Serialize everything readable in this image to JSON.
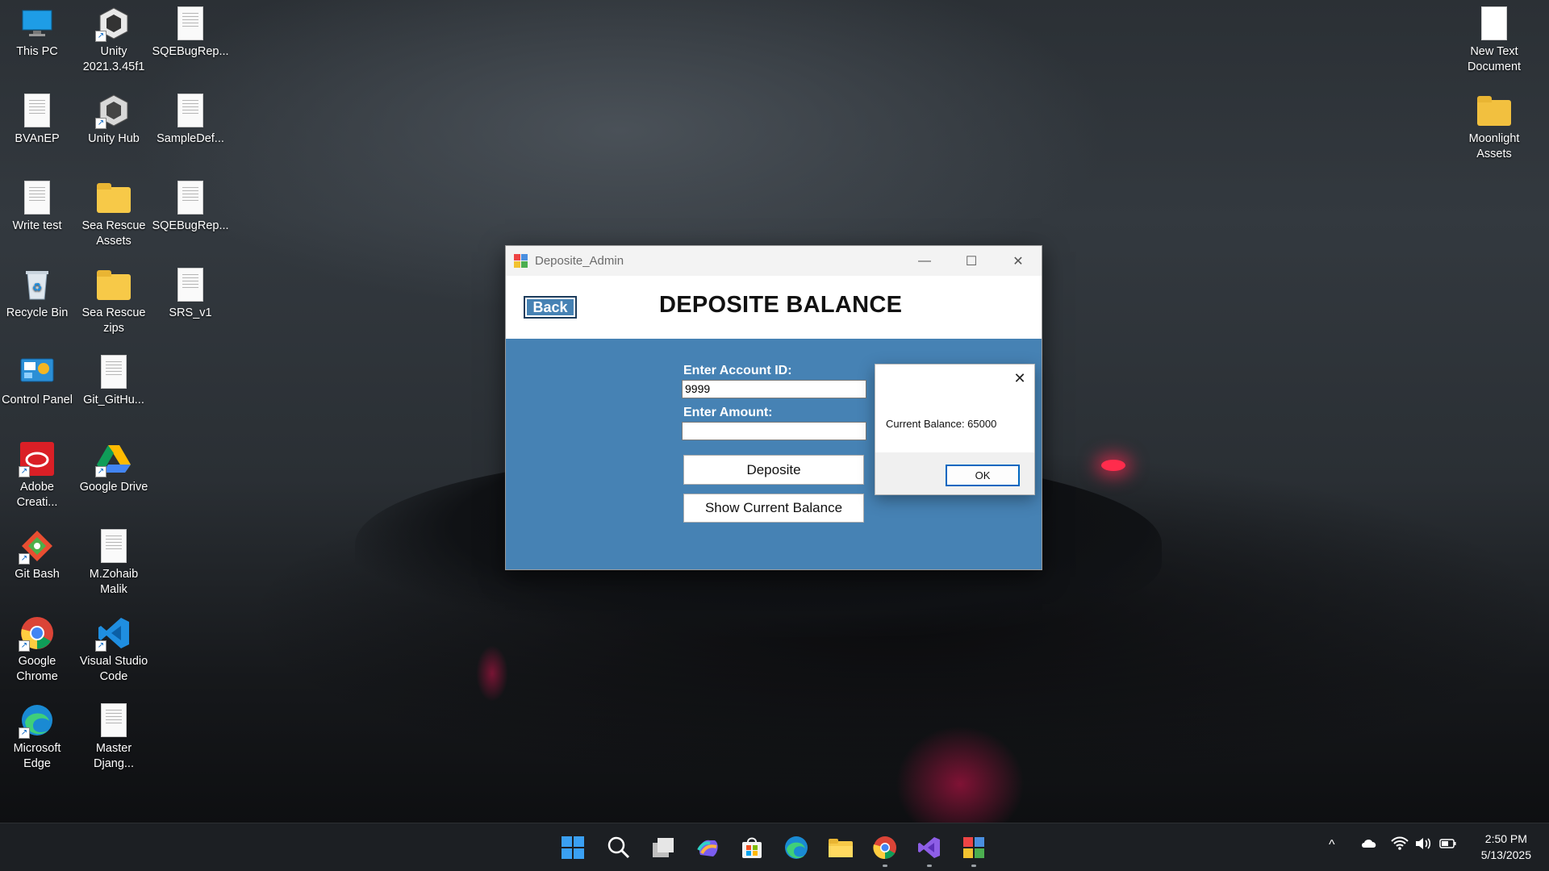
{
  "desktop": {
    "icons": [
      {
        "label": "This PC"
      },
      {
        "label": "Unity 2021.3.45f1"
      },
      {
        "label": "SQEBugRep..."
      },
      {
        "label": "BVAnEP"
      },
      {
        "label": "Unity Hub"
      },
      {
        "label": "SampleDef..."
      },
      {
        "label": "Write test"
      },
      {
        "label": "Sea Rescue Assets"
      },
      {
        "label": "SQEBugRep..."
      },
      {
        "label": "Recycle Bin"
      },
      {
        "label": "Sea Rescue zips"
      },
      {
        "label": "SRS_v1"
      },
      {
        "label": "Control Panel"
      },
      {
        "label": "Git_GitHu..."
      },
      {
        "label": "Adobe Creati..."
      },
      {
        "label": "Google Drive"
      },
      {
        "label": "Git Bash"
      },
      {
        "label": "M.Zohaib Malik"
      },
      {
        "label": "Google Chrome"
      },
      {
        "label": "Visual Studio Code"
      },
      {
        "label": "Microsoft Edge"
      },
      {
        "label": "Master Djang..."
      },
      {
        "label": "New Text Document"
      },
      {
        "label": "Moonlight Assets"
      }
    ]
  },
  "window": {
    "title": "Deposite_Admin",
    "minimize_glyph": "—",
    "maximize_glyph": "☐",
    "close_glyph": "✕",
    "back_label": "Back",
    "heading": "DEPOSITE BALANCE",
    "account_label": "Enter Account ID:",
    "account_value": "9999",
    "amount_label": "Enter Amount:",
    "amount_value": "",
    "deposit_button": "Deposite",
    "balance_button": "Show Current Balance",
    "bg_color": "#4682b4"
  },
  "message_box": {
    "text": "Current Balance: 65000",
    "ok_label": "OK",
    "close_glyph": "✕"
  },
  "taskbar": {
    "apps": [
      "start-icon",
      "search-icon",
      "task-view-icon",
      "copilot-icon",
      "store-icon",
      "edge-icon",
      "file-explorer-icon",
      "chrome-icon",
      "visual-studio-icon",
      "winforms-app-icon"
    ],
    "tray_chevron": "^",
    "time": "2:50 PM",
    "date": "5/13/2025"
  }
}
